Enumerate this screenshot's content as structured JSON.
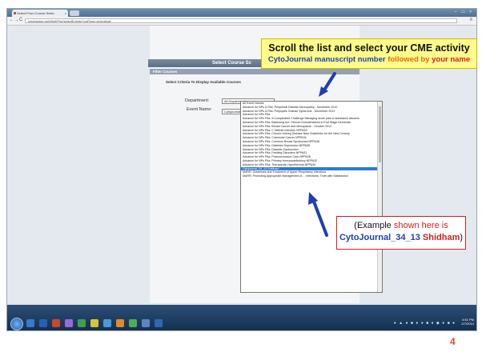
{
  "browser": {
    "tab_title": "Select From Course Selec",
    "tab_close": "×",
    "window_buttons": "– ▭ ×",
    "back_icon": "←",
    "forward_icon": "→",
    "reload_icon": "C",
    "url": "cmetracker.net/Wolf/Pub/selectEvents?catType=enduring#",
    "menu_icon": "≡"
  },
  "page": {
    "title": "Select Course Sc",
    "filter_header": "Filter Courses",
    "criteria_text": "Select Criteria To Display Available Courses",
    "department_label": "Department:",
    "department_value": "All Departments",
    "event_label": "Event Name:",
    "event_value": "Cytojournal_34_13 Shidham",
    "event_options": [
      "All Event Names",
      "Advance for NPs & PAs: Peripheral Diabetic Neuropathy - November 2012",
      "Advance for NPs & PAs: Polycystic Ovarian Syndrome - December 2012",
      "Advance for NPs PAs",
      "Advance for NPs PAs: A Complicated Challenge Managing acute pain in substance abusers",
      "Advance for NPs PAs: Balancing Act: Clinical Considerations in End Stage Dementia",
      "Advance for NPs PAs: Breast Cancer and Menopause - October 2012",
      "Advance for NPs PAs: C Difficile Infection NPPA39",
      "Advance for NPs PAs: Chronic Kidney Disease New Guidelines for the New Century",
      "Advance for NPs PAs: Colorectal Cancer NPPA34",
      "Advance for NPs PAs: Common Breast Syndromes NPPA38",
      "Advance for NPs PAs: Diabetes Depression NPPA35",
      "Advance for NPs PAs: Diastolic Dysfunction",
      "Advance for NPs PAs: Feeding Disorders NPPA31",
      "Advance for NPs PAs: Postconcussion Care NPPA28",
      "Advance for NPs PAs: Primary Immunodeficiency NPPA32",
      "Advance for NPs PAs: Therapeutic Hypothermia NPPA30",
      "Cytojournal_34_13 Shidham",
      "MARR: Guidelines and Treatment of Upper Respiratory Infections",
      "MARR: Promoting Appropriate Management of ... Infections: Truth with Satisfaction"
    ],
    "selected_index": 17
  },
  "callout": {
    "line1": "Scroll the list and select your CME activity",
    "line2_a": "CytoJournal manuscript number",
    "line2_b": " followed by ",
    "line2_c": "your name"
  },
  "example": {
    "line1_a": "(Example ",
    "line1_b": "shown here is",
    "line2_a": "CytoJournal_34_13 ",
    "line2_b": "Shidham",
    "line2_c": ")"
  },
  "taskbar": {
    "clock_time": "4:51 PM",
    "clock_date": "2/7/2014"
  },
  "slide_number": "4",
  "colors": {
    "callout_bg": "#fffd8a",
    "arrow_blue": "#1f3fb0",
    "accent_red": "#d41f1f",
    "accent_orange": "#e86a0a",
    "selection_blue": "#2f7bd6"
  }
}
